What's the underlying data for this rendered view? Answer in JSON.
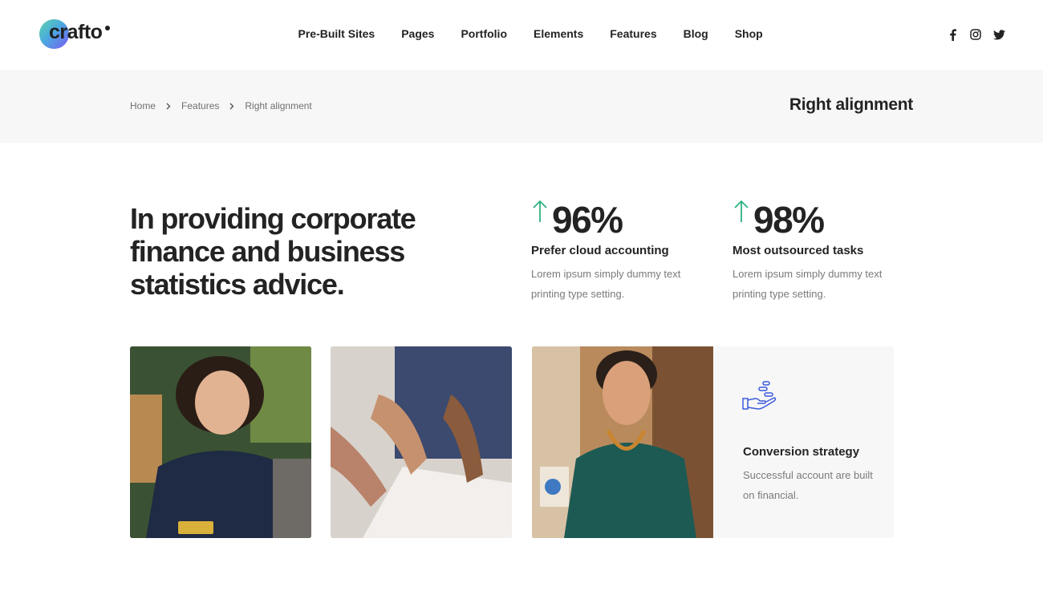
{
  "brand": {
    "logo_text": "crafto"
  },
  "nav": {
    "items": [
      "Pre-Built Sites",
      "Pages",
      "Portfolio",
      "Elements",
      "Features",
      "Blog",
      "Shop"
    ]
  },
  "social": {
    "icons": [
      "facebook-icon",
      "instagram-icon",
      "twitter-icon"
    ]
  },
  "breadcrumb": {
    "items": [
      "Home",
      "Features",
      "Right alignment"
    ]
  },
  "page_title": "Right alignment",
  "hero": {
    "headline": "In providing corporate finance and business statistics advice."
  },
  "stats": [
    {
      "value": "96%",
      "title": "Prefer cloud accounting",
      "description": "Lorem ipsum simply dummy text printing type setting."
    },
    {
      "value": "98%",
      "title": "Most outsourced tasks",
      "description": "Lorem ipsum simply dummy text printing type setting."
    }
  ],
  "feature_card": {
    "icon": "hand-coins-icon",
    "title": "Conversion strategy",
    "description": "Successful account are built on financial."
  },
  "colors": {
    "accent_green": "#2fb380",
    "icon_blue": "#3b5bdb",
    "text_dark": "#232323",
    "text_muted": "#7a7a7a",
    "bar_bg": "#f7f7f7"
  }
}
